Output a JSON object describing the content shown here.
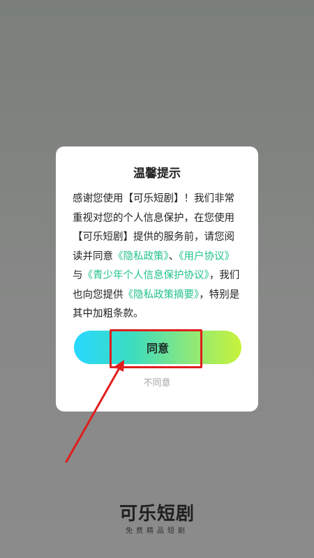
{
  "dialog": {
    "title": "温馨提示",
    "body": {
      "p1": "感谢您使用【可乐短剧】！我们非常重视对您的个人信息保护，在您使用【可乐短剧】提供的服务前，请您阅读并同意",
      "link_privacy": "《隐私政策》",
      "sep1": "、",
      "link_user": "《用户协议》",
      "sep2": "与",
      "link_youth": "《青少年个人信息保护协议》",
      "p2": "，我们也向您提供",
      "link_summary": "《隐私政策摘要》",
      "p3": "，特别是其中加粗条款。"
    },
    "agree_label": "同意",
    "disagree_label": "不同意"
  },
  "brand": {
    "logo": "可乐短剧",
    "slogan": "免费精品短剧"
  },
  "colors": {
    "link": "#22c28a",
    "annotation": "#e01e1e"
  }
}
